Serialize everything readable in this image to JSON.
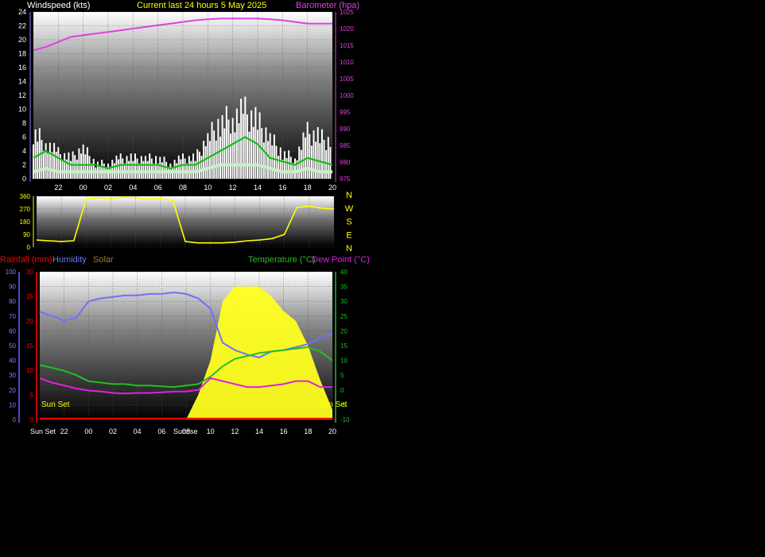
{
  "header": {
    "title": "Current last 24 hours 5 May 2025",
    "wind_label": "Windspeed (kts)",
    "baro_label": "Barometer (hpa)"
  },
  "footer_panel": {
    "rain_label": "Rainfall (mm)",
    "hum_label": "Humidity",
    "solar_label": "Solar",
    "temp_label": "Temperature (°C)",
    "dew_label": "Dew Point (°C)",
    "sunset_left": "Sun Set",
    "sunset_right": "Sun Set",
    "sunset_axis": "Sun Set",
    "sunrise_axis": "Sunrise"
  },
  "colors": {
    "wind": "#ffffff",
    "wind_avg": "#00c000",
    "wind_light": "#c8f0c8",
    "baro": "#e040e0",
    "dir": "#ffff00",
    "rain": "#ff0000",
    "hum": "#7070ff",
    "temp": "#20c020",
    "dew": "#e020e0",
    "solar": "#ffff20",
    "title": "#ffff00"
  },
  "chart_data": [
    {
      "type": "line",
      "id": "wind",
      "x_ticks": [
        "22",
        "00",
        "02",
        "04",
        "06",
        "08",
        "10",
        "12",
        "14",
        "16",
        "18",
        "20"
      ],
      "ylim": [
        0,
        24
      ],
      "y_ticks": [
        "0",
        "2",
        "4",
        "6",
        "8",
        "10",
        "12",
        "14",
        "16",
        "18",
        "20",
        "22",
        "24"
      ],
      "y2lim": [
        975,
        1025
      ],
      "y2_ticks": [
        "975",
        "980",
        "985",
        "990",
        "995",
        "1000",
        "1005",
        "1010",
        "1015",
        "1020",
        "1025"
      ],
      "x": [
        20,
        21,
        22,
        23,
        0,
        1,
        2,
        3,
        4,
        5,
        6,
        7,
        8,
        9,
        10,
        11,
        12,
        13,
        14,
        15,
        16,
        17,
        18,
        19,
        20
      ],
      "series": [
        {
          "name": "Windspeed (kts)",
          "role": "gust",
          "values": [
            9,
            7,
            5,
            4,
            6,
            3,
            3,
            4,
            4,
            4,
            4,
            3,
            4,
            4,
            8,
            11,
            12,
            13,
            11,
            8,
            5,
            4,
            9,
            8,
            7
          ]
        },
        {
          "name": "Windspeed (kts)",
          "role": "avg",
          "values": [
            3,
            4,
            3,
            2,
            2,
            2,
            1.5,
            2,
            2,
            2,
            2,
            1.5,
            2,
            2,
            3,
            4,
            5,
            6,
            5,
            3,
            2.5,
            2,
            3,
            2.5,
            2
          ]
        },
        {
          "name": "Windspeed (kts)",
          "role": "low",
          "values": [
            1,
            1.5,
            1,
            1,
            1,
            1,
            1,
            1,
            1,
            1,
            1,
            1,
            1,
            1,
            1.5,
            2,
            2,
            2,
            2,
            1.5,
            1,
            1,
            1.5,
            1,
            1
          ]
        },
        {
          "name": "Barometer (hpa)",
          "values": [
            1013.5,
            1014.5,
            1016,
            1017.5,
            1018,
            1018.5,
            1019,
            1019.5,
            1020,
            1020.5,
            1021,
            1021.5,
            1022,
            1022.5,
            1022.8,
            1023,
            1023,
            1023,
            1023,
            1022.8,
            1022.5,
            1022,
            1021.5,
            1021.5,
            1021.5
          ]
        }
      ]
    },
    {
      "type": "line",
      "id": "direction",
      "ylim": [
        0,
        360
      ],
      "y_ticks": [
        "0",
        "90",
        "180",
        "270",
        "360"
      ],
      "compass": [
        "N",
        "W",
        "S",
        "E",
        "N"
      ],
      "x": [
        20,
        21,
        22,
        23,
        0,
        1,
        2,
        3,
        4,
        5,
        6,
        7,
        8,
        9,
        10,
        11,
        12,
        13,
        14,
        15,
        16,
        17,
        18,
        19,
        20
      ],
      "series": [
        {
          "name": "Direction",
          "values": [
            50,
            45,
            40,
            45,
            340,
            350,
            345,
            355,
            350,
            340,
            345,
            330,
            40,
            30,
            30,
            30,
            35,
            45,
            50,
            60,
            90,
            280,
            290,
            275,
            270
          ]
        }
      ]
    },
    {
      "type": "line",
      "id": "temp",
      "x_ticks": [
        "22",
        "00",
        "02",
        "04",
        "06",
        "08",
        "10",
        "12",
        "14",
        "16",
        "18",
        "20"
      ],
      "hum_ticks": [
        "0",
        "10",
        "20",
        "30",
        "40",
        "50",
        "60",
        "70",
        "80",
        "90",
        "100"
      ],
      "rain_ticks": [
        "0",
        "5",
        "10",
        "15",
        "20",
        "25",
        "30"
      ],
      "temp_ticks": [
        "-10",
        "-5",
        "0",
        "5",
        "10",
        "15",
        "20",
        "25",
        "30",
        "35",
        "40"
      ],
      "hum_lim": [
        0,
        100
      ],
      "rain_lim": [
        0,
        30
      ],
      "temp_lim": [
        -10,
        40
      ],
      "x": [
        20,
        21,
        22,
        23,
        0,
        1,
        2,
        3,
        4,
        5,
        6,
        7,
        8,
        9,
        10,
        11,
        12,
        13,
        14,
        15,
        16,
        17,
        18,
        19,
        20
      ],
      "series": [
        {
          "name": "Humidity",
          "values": [
            73,
            70,
            67,
            69,
            80,
            82,
            83,
            84,
            84,
            85,
            85,
            86,
            85,
            82,
            75,
            52,
            47,
            44,
            42,
            46,
            47,
            49,
            51,
            55,
            58
          ]
        },
        {
          "name": "Temperature (°C)",
          "values": [
            8.5,
            7.5,
            6.5,
            5,
            3,
            2.5,
            2,
            2,
            1.5,
            1.5,
            1.2,
            1,
            1.5,
            2,
            4.5,
            8,
            10.5,
            11.5,
            12.5,
            13,
            13.5,
            14,
            14.5,
            13,
            10
          ]
        },
        {
          "name": "Dew Point (°C)",
          "values": [
            4,
            2.5,
            1.5,
            0.5,
            -0.2,
            -0.5,
            -1,
            -1.2,
            -1,
            -1,
            -0.8,
            -0.5,
            -0.5,
            0,
            4,
            3,
            2,
            1,
            1,
            1.5,
            2,
            3,
            3,
            1,
            1
          ]
        },
        {
          "name": "Rainfall (mm)",
          "values": [
            0.2,
            0.2,
            0.2,
            0.2,
            0.2,
            0.2,
            0.2,
            0.2,
            0.2,
            0.2,
            0.2,
            0.2,
            0.2,
            0.2,
            0.2,
            0.2,
            0.2,
            0.2,
            0.2,
            0.2,
            0.2,
            0.2,
            0.2,
            0.2,
            0.2
          ]
        },
        {
          "name": "Solar",
          "values": [
            0,
            0,
            0,
            0,
            0,
            0,
            0,
            0,
            0,
            0,
            0,
            0,
            0,
            5,
            12,
            24,
            27,
            27,
            27,
            25,
            22,
            20,
            15,
            8,
            2
          ]
        }
      ]
    }
  ]
}
